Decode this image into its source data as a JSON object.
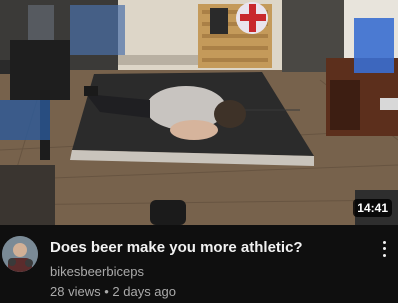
{
  "video": {
    "duration": "14:41",
    "title": "Does beer make you more athletic?",
    "channel": "bikesbeerbiceps",
    "views": "28 views",
    "separator": "•",
    "age": "2 days ago"
  },
  "icons": {
    "more": "more-vert-icon"
  },
  "colors": {
    "background": "#0f0f0f",
    "title": "#f1f1f1",
    "secondary_text": "#aaaaaa",
    "duration_badge": "#000000"
  }
}
